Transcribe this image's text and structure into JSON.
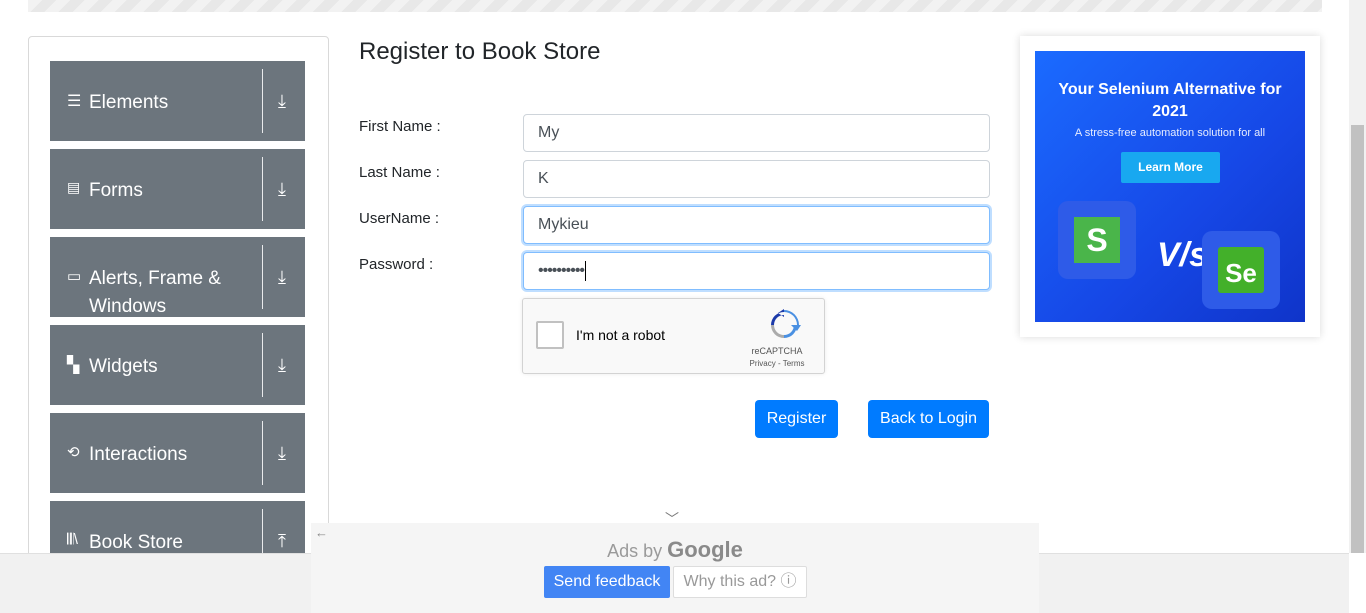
{
  "sidebar": {
    "groups": [
      {
        "icon": "menu-icon",
        "label": "Elements",
        "arrow": "download-icon"
      },
      {
        "icon": "document-icon",
        "label": "Forms",
        "arrow": "download-icon"
      },
      {
        "icon": "window-icon",
        "label": "Alerts, Frame &",
        "label2": "Windows",
        "arrow": "download-icon"
      },
      {
        "icon": "widgets-icon",
        "label": "Widgets",
        "arrow": "download-icon"
      },
      {
        "icon": "interactions-icon",
        "label": "Interactions",
        "arrow": "download-icon"
      },
      {
        "icon": "books-icon",
        "label": "Book Store",
        "arrow": "upload-icon"
      }
    ]
  },
  "form": {
    "title": "Register to Book Store",
    "first_name_label": "First Name :",
    "first_name_value": "My",
    "last_name_label": "Last Name :",
    "last_name_value": "K",
    "username_label": "UserName :",
    "username_value": "Mykieu",
    "password_label": "Password :",
    "password_value": "••••••••••",
    "captcha_text": "I'm not a robot",
    "captcha_brand": "reCAPTCHA",
    "captcha_links": "Privacy - Terms",
    "register_label": "Register",
    "back_label": "Back to Login"
  },
  "ad": {
    "headline": "Your Selenium Alternative for 2021",
    "subline": "A stress-free automation solution for all",
    "cta": "Learn More",
    "vs": "V/s",
    "logo_left": "S",
    "logo_right": "Se"
  },
  "ad_footer": {
    "ads_by": "Ads by",
    "google": "Google",
    "send_feedback": "Send feedback",
    "why_this_ad": "Why this ad? ⓘ"
  },
  "colors": {
    "sidebar_group": "#6c757d",
    "primary_button": "#007bff",
    "feedback_button": "#4285f4"
  }
}
